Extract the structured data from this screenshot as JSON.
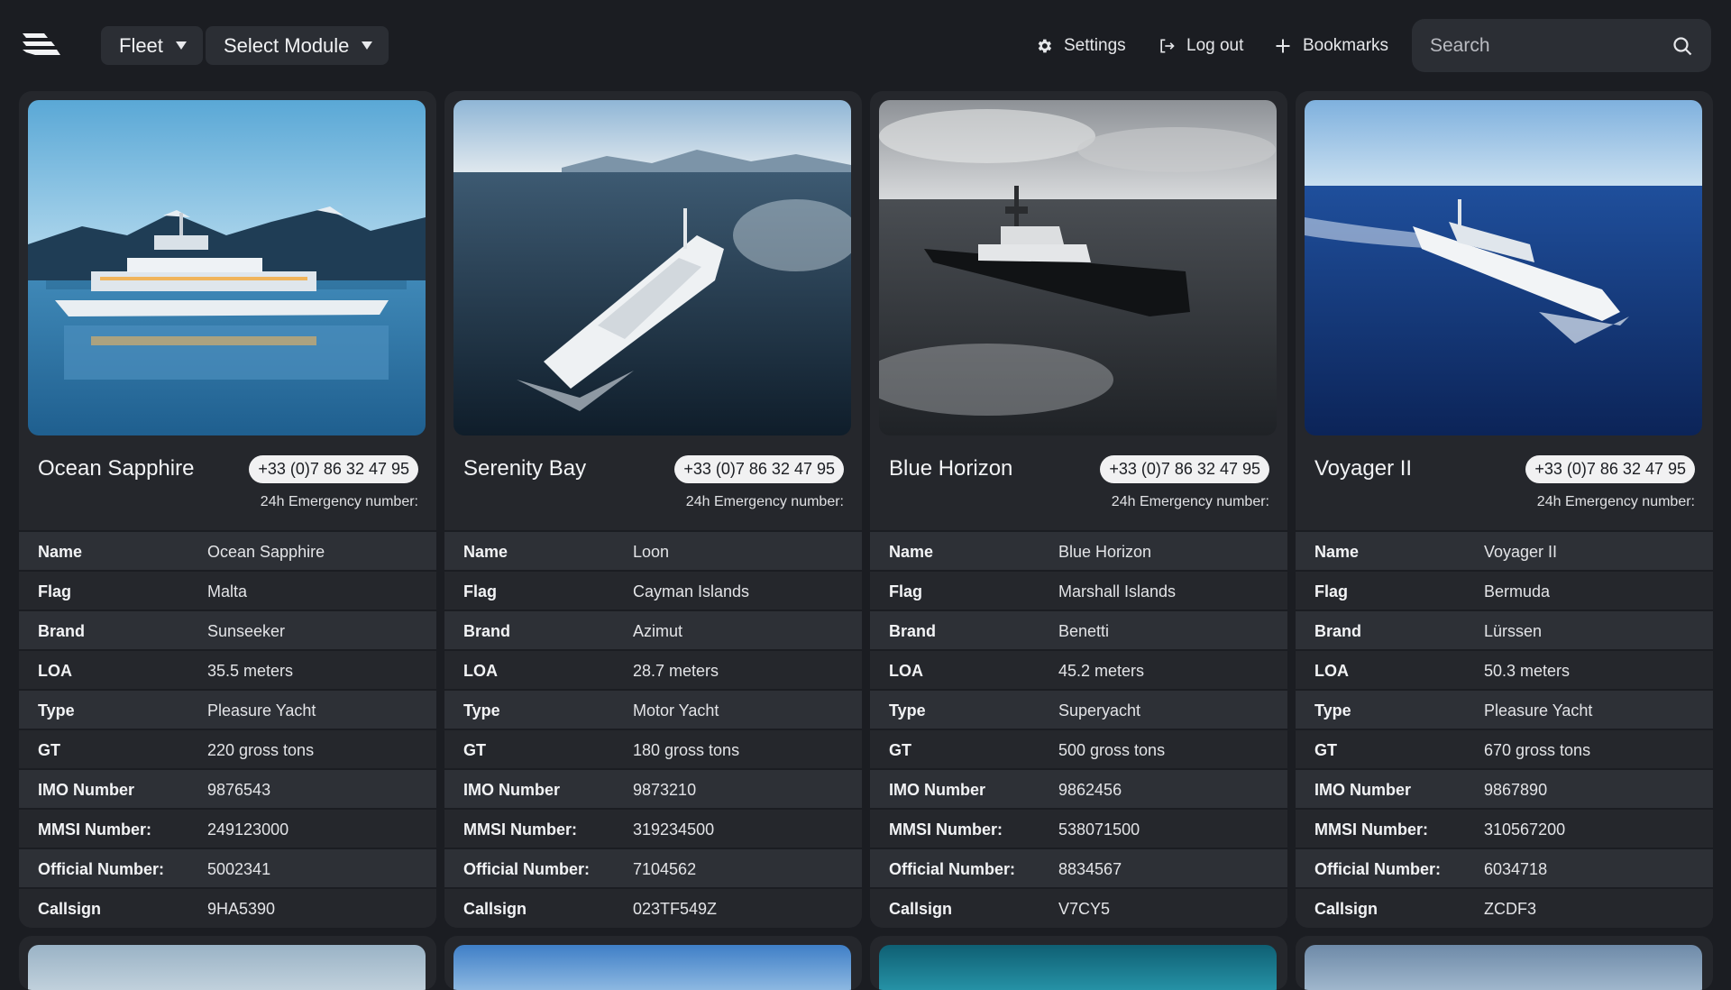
{
  "header": {
    "fleet_label": "Fleet",
    "module_label": "Select Module",
    "settings_label": "Settings",
    "logout_label": "Log out",
    "bookmarks_label": "Bookmarks",
    "search_placeholder": "Search"
  },
  "labels": {
    "emergency": "24h Emergency number:",
    "name": "Name",
    "flag": "Flag",
    "brand": "Brand",
    "loa": "LOA",
    "type": "Type",
    "gt": "GT",
    "imo": "IMO Number",
    "mmsi": "MMSI Number:",
    "official": "Official Number:",
    "callsign": "Callsign"
  },
  "vessels": [
    {
      "title": "Ocean Sapphire",
      "phone": "+33 (0)7 86 32 47 95",
      "name": "Ocean Sapphire",
      "flag": "Malta",
      "brand": "Sunseeker",
      "loa": "35.5 meters",
      "type": "Pleasure Yacht",
      "gt": "220 gross tons",
      "imo": "9876543",
      "mmsi": "249123000",
      "official": "5002341",
      "callsign": "9HA5390",
      "image": "white yacht near snowy mountains on calm blue water"
    },
    {
      "title": "Serenity Bay",
      "phone": "+33 (0)7 86 32 47 95",
      "name": "Loon",
      "flag": "Cayman Islands",
      "brand": "Azimut",
      "loa": "28.7 meters",
      "type": "Motor Yacht",
      "gt": "180 gross tons",
      "imo": "9873210",
      "mmsi": "319234500",
      "official": " 7104562",
      "callsign": "023TF549Z",
      "image": "white yacht cruising on dark sea toward mountains"
    },
    {
      "title": "Blue Horizon",
      "phone": "+33 (0)7 86 32 47 95",
      "name": "Blue Horizon",
      "flag": "Marshall Islands",
      "brand": "Benetti",
      "loa": "45.2 meters",
      "type": "Superyacht",
      "gt": "500 gross tons",
      "imo": "9862456",
      "mmsi": "538071500",
      "official": "8834567",
      "callsign": "V7CY5",
      "image": "dark hulled superyacht on grey sparkling sea"
    },
    {
      "title": "Voyager II",
      "phone": "+33 (0)7 86 32 47 95",
      "name": "Voyager II",
      "flag": "Bermuda",
      "brand": "Lürssen",
      "loa": "50.3 meters",
      "type": "Pleasure Yacht",
      "gt": "670 gross tons",
      "imo": "9867890",
      "mmsi": "310567200",
      "official": "6034718",
      "callsign": "ZCDF3",
      "image": "white yacht speeding on deep blue ocean"
    }
  ],
  "colors": {
    "background": "#1b1d22",
    "card": "#25272c",
    "row_alt": "#2d3036",
    "pill": "#f1f1f2"
  }
}
